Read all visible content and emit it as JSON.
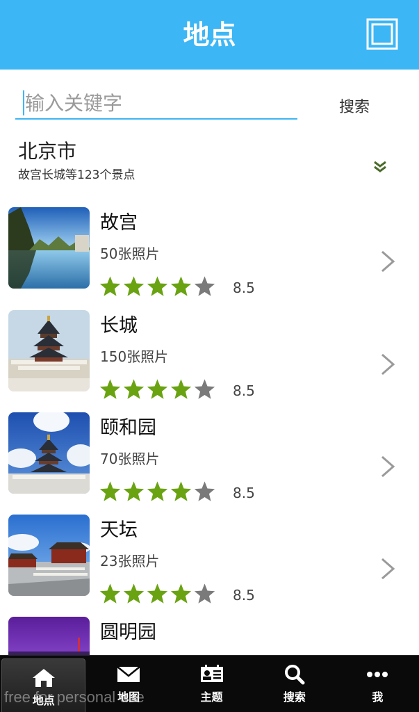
{
  "header": {
    "title": "地点",
    "icon": "square-frame-icon"
  },
  "search": {
    "placeholder": "输入关键字",
    "value": "",
    "button_label": "搜索"
  },
  "city": {
    "name": "北京市",
    "description": "故宫长城等123个景点",
    "icon": "double-chevron-down-icon"
  },
  "places": [
    {
      "name": "故宫",
      "photos": "50张照片",
      "rating": "8.5",
      "stars": 4
    },
    {
      "name": "长城",
      "photos": "150张照片",
      "rating": "8.5",
      "stars": 4
    },
    {
      "name": "颐和园",
      "photos": "70张照片",
      "rating": "8.5",
      "stars": 4
    },
    {
      "name": "天坛",
      "photos": "23张照片",
      "rating": "8.5",
      "stars": 4
    },
    {
      "name": "圆明园",
      "photos": "",
      "rating": "",
      "stars": 0
    }
  ],
  "nav": {
    "items": [
      {
        "label": "地点",
        "icon": "home-icon",
        "active": true
      },
      {
        "label": "地图",
        "icon": "envelope-icon",
        "active": false
      },
      {
        "label": "主题",
        "icon": "contact-card-icon",
        "active": false
      },
      {
        "label": "搜索",
        "icon": "search-icon",
        "active": false
      },
      {
        "label": "我",
        "icon": "more-dots-icon",
        "active": false
      }
    ]
  },
  "watermark": "free for personal use",
  "colors": {
    "accent": "#3db6f5",
    "star_filled": "#6aa312",
    "star_empty": "#7a7a7a",
    "nav_background": "#0a0a0a"
  }
}
